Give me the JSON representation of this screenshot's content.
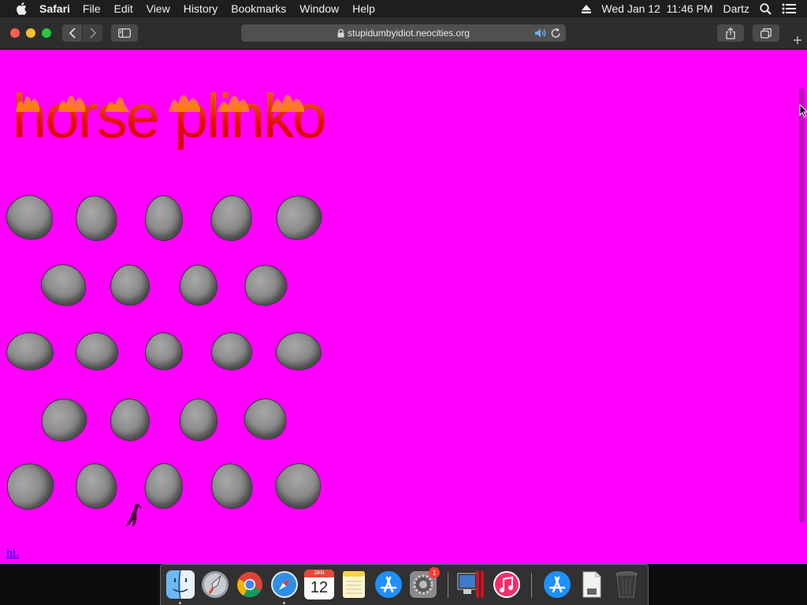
{
  "menubar": {
    "app_name": "Safari",
    "items": [
      "File",
      "Edit",
      "View",
      "History",
      "Bookmarks",
      "Window",
      "Help"
    ],
    "date_time": "Wed Jan 12  11:46 PM",
    "user": "Dartz"
  },
  "browser": {
    "url": "stupidumbyidiot.neocities.org"
  },
  "page": {
    "title": "horse plinko",
    "link_text": "hi."
  },
  "dock": {
    "calendar_month": "JAN",
    "calendar_day": "12",
    "badge_count": "1"
  },
  "colors": {
    "page_background": "#ff00ff",
    "title_fire": "#ff1a00",
    "peg_gray": "#8c8c8c",
    "link": "#0000ee"
  }
}
